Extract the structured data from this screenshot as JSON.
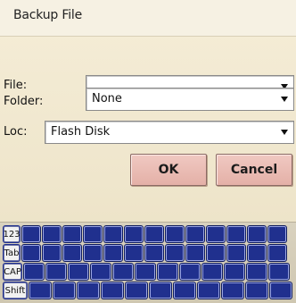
{
  "dialog": {
    "title": "Backup File",
    "fields": [
      {
        "label": "File:",
        "value": ""
      },
      {
        "label": "Folder:",
        "value": "None"
      },
      {
        "label": "Loc:",
        "value": "Flash Disk"
      }
    ],
    "ok_label": "OK",
    "cancel_label": "Cancel"
  },
  "keyboard": {
    "rows": [
      {
        "lead": "123",
        "keys": 13
      },
      {
        "lead": "Tab",
        "keys": 13
      },
      {
        "lead": "CAP",
        "keys": 12
      },
      {
        "lead": "Shift",
        "keys": 11
      }
    ]
  },
  "colors": {
    "key": "#20308e",
    "button": "#e9bbb3",
    "background": "#efe6cc"
  }
}
